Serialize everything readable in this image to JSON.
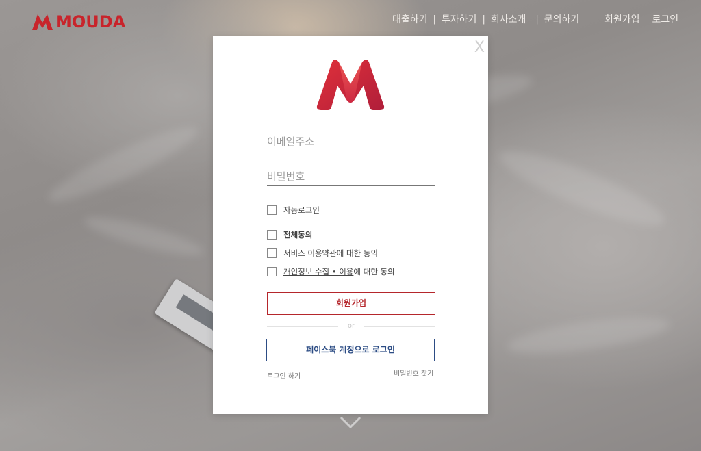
{
  "header": {
    "brand": "MOUDA",
    "nav": [
      "대출하기",
      "투자하기",
      "회사소개",
      "문의하기"
    ],
    "nav_separator": "|",
    "auth": [
      "회원가입",
      "로그인"
    ]
  },
  "modal": {
    "close_label": "X",
    "email_placeholder": "이메일주소",
    "password_placeholder": "비밀번호",
    "auto_login": "자동로그인",
    "agree_all": "전체동의",
    "terms_link": "서비스 이용약관",
    "terms_suffix": "에 대한 동의",
    "privacy_link": "개인정보 수집 • 이용",
    "privacy_suffix": "에 대한 동의",
    "signup_button": "회원가입",
    "or_label": "or",
    "facebook_button": "페이스북 계정으로 로그인",
    "login_link": "로그인 하기",
    "find_password_link": "비밀번호 찾기"
  },
  "colors": {
    "brand_red": "#c8242b",
    "signup_red": "#b5272c",
    "facebook_blue": "#2c4c84"
  },
  "icons": [
    "brand-logo-icon",
    "close-icon",
    "checkbox-icon",
    "chevron-down-icon"
  ]
}
